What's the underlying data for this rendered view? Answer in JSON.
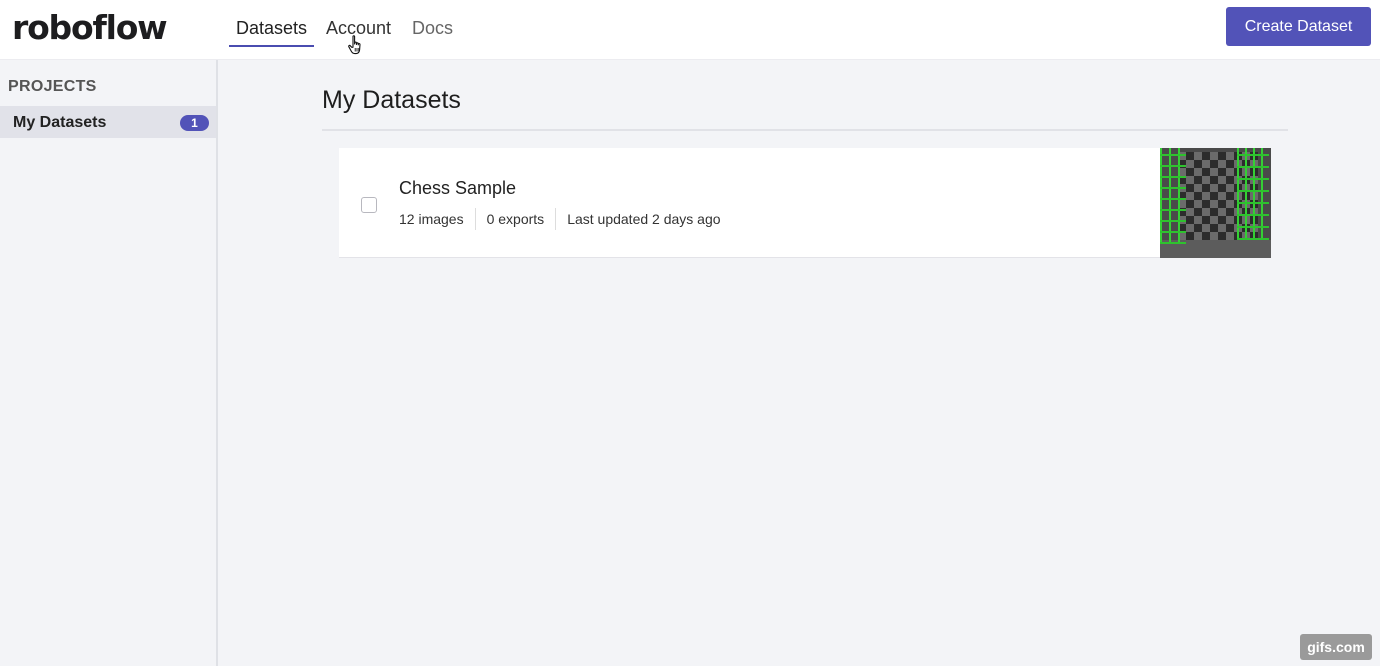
{
  "app": {
    "logo": "roboflow"
  },
  "nav": {
    "tabs": [
      {
        "label": "Datasets",
        "active": true
      },
      {
        "label": "Account",
        "active": false
      },
      {
        "label": "Docs",
        "active": false
      }
    ],
    "create_button": "Create Dataset"
  },
  "sidebar": {
    "heading": "PROJECTS",
    "items": [
      {
        "label": "My Datasets",
        "count": "1"
      }
    ]
  },
  "main": {
    "title": "My Datasets",
    "datasets": [
      {
        "name": "Chess Sample",
        "images": "12 images",
        "exports": "0 exports",
        "updated": "Last updated 2 days ago",
        "checked": false
      }
    ]
  },
  "watermark": "gifs.com",
  "colors": {
    "accent": "#5253b8",
    "annotation_box": "#2ec22e"
  },
  "icons": {
    "cursor": "hand-pointer-icon"
  }
}
